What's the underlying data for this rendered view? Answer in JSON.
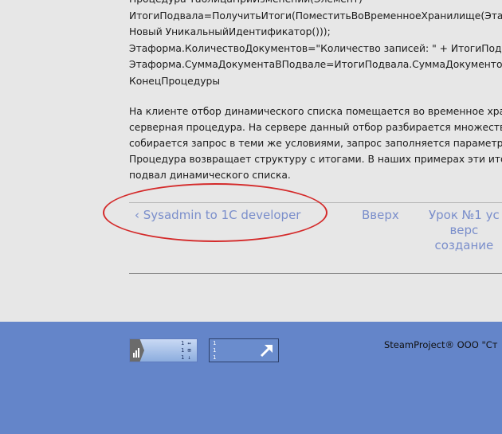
{
  "code_lines": [
    "Процедура ТаблицаПриИзменении(Элемент)",
    "ИтогиПодвала=ПолучитьИтоги(ПоместитьВоВременноеХранилище(Этафо",
    "Новый УникальныйИдентификатор()));",
    "Этаформа.КоличествоДокументов=\"Количество записей: \" + ИтогиПодва",
    "Этаформа.СуммаДокументаВПодвале=ИтогиПодвала.СуммаДокументов;",
    "КонецПроцедуры"
  ],
  "paragraph_lines": [
    "На клиенте отбор динамического списка помещается во временное хран",
    "серверная процедура. На сервере данный отбор разбирается множество",
    "собирается запрос в теми же условиями, запрос заполняется параметрам",
    "Процедура возвращает структуру с итогами. В наших примерах эти итог",
    "подвал динамического списка."
  ],
  "book_navigation": {
    "prev_label": "‹ Sysadmin to 1C developer",
    "up_label": "Вверх",
    "next_label_lines": [
      "Урок №1 ус",
      "верс",
      "создание"
    ]
  },
  "highlight_color": "#d42a2a",
  "footer": {
    "copyright": "SteamProject® ООО \"Ст",
    "counter1_digits": [
      "1 ↔",
      "1 ⊞",
      "1 ↓"
    ],
    "counter1_logo_icon": "bar-chart-icon",
    "counter2_digits": [
      "1",
      "1",
      "1"
    ],
    "counter2_icon": "arrow-up-right-icon",
    "background_color": "#6485c9"
  }
}
